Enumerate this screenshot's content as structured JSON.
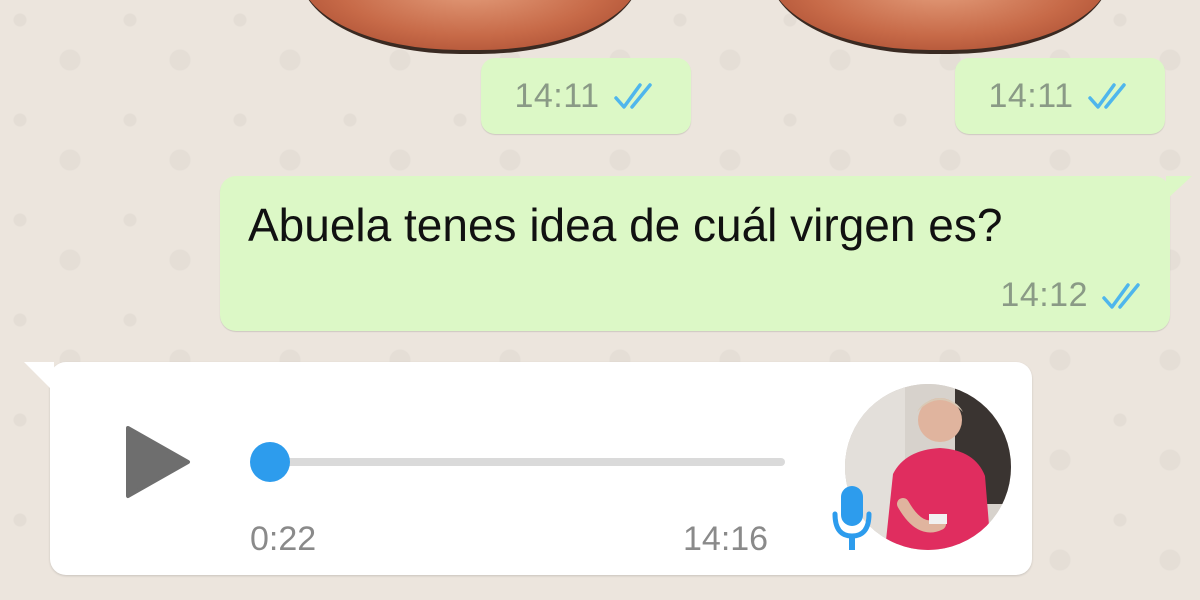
{
  "messages": {
    "sticker_left": {
      "time": "14:11",
      "status": "read"
    },
    "sticker_right": {
      "time": "14:11",
      "status": "read"
    },
    "text_outgoing": {
      "text": "Abuela tenes idea de cuál virgen es?",
      "time": "14:12",
      "status": "read"
    },
    "voice_incoming": {
      "duration": "0:22",
      "time": "14:16",
      "progress": 0
    }
  },
  "icons": {
    "ticks": "double-check-icon",
    "play": "play-icon",
    "mic": "microphone-icon"
  },
  "colors": {
    "chat_background": "#ece5dd",
    "outgoing_bubble": "#dcf8c6",
    "incoming_bubble": "#ffffff",
    "read_ticks": "#4fb6ec",
    "accent": "#2d9ced",
    "timestamp": "#8a9a86"
  }
}
